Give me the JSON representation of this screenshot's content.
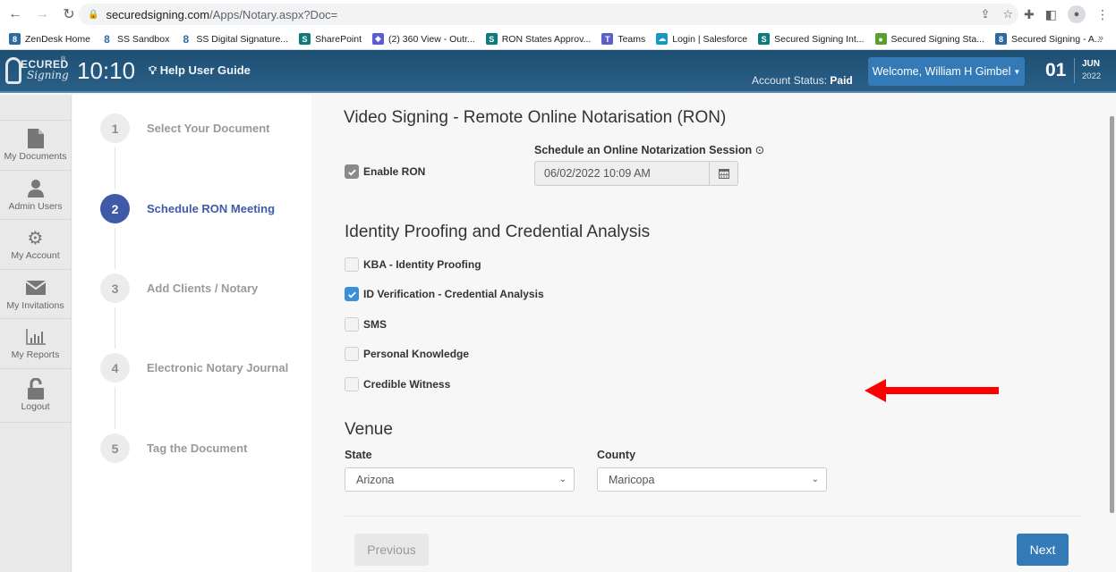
{
  "browser": {
    "url_host": "securedsigning.com",
    "url_path": "/Apps/Notary.aspx?Doc=",
    "bookmarks": [
      {
        "label": "ZenDesk Home",
        "icon": "zendesk-icon",
        "color": "#2d6a9f",
        "glyph": "8"
      },
      {
        "label": "SS Sandbox",
        "icon": "secured-signing-icon",
        "color": "#ffffff",
        "glyph": "8"
      },
      {
        "label": "SS Digital Signature...",
        "icon": "secured-signing-icon",
        "color": "#ffffff",
        "glyph": "8"
      },
      {
        "label": "SharePoint",
        "icon": "sharepoint-icon",
        "color": "#0e7a7a",
        "glyph": "S"
      },
      {
        "label": "(2) 360 View - Outr...",
        "icon": "shield-icon",
        "color": "#5b5bd6",
        "glyph": "◆"
      },
      {
        "label": "RON States Approv...",
        "icon": "sharepoint-icon",
        "color": "#0e7a7a",
        "glyph": "S"
      },
      {
        "label": "Teams",
        "icon": "teams-icon",
        "color": "#5b5fc7",
        "glyph": "T"
      },
      {
        "label": "Login | Salesforce",
        "icon": "salesforce-icon",
        "color": "#1798c1",
        "glyph": "☁"
      },
      {
        "label": "Secured Signing Int...",
        "icon": "sharepoint-icon",
        "color": "#0e7a7a",
        "glyph": "S"
      },
      {
        "label": "Secured Signing Sta...",
        "icon": "status-icon",
        "color": "#5aa02c",
        "glyph": "●"
      },
      {
        "label": "Secured Signing - A...",
        "icon": "secured-signing-icon",
        "color": "#2d6a9f",
        "glyph": "8"
      }
    ],
    "more": "»"
  },
  "header": {
    "logo_top": "ECURED",
    "logo_bottom": "Signing",
    "logo_reg": "®",
    "clock": "10:10",
    "help": "Help User Guide",
    "account_status_label": "Account Status:",
    "account_status_value": "Paid",
    "welcome": "Welcome,  William H Gimbel",
    "date_day": "01",
    "date_month": "JUN",
    "date_year": "2022"
  },
  "sidebar": {
    "items": [
      {
        "label": "My Documents",
        "icon": "document-icon"
      },
      {
        "label": "Admin Users",
        "icon": "user-icon"
      },
      {
        "label": "My Account",
        "icon": "gear-icon"
      },
      {
        "label": "My Invitations",
        "icon": "envelope-icon"
      },
      {
        "label": "My Reports",
        "icon": "bar-chart-icon"
      },
      {
        "label": "Logout",
        "icon": "unlock-icon"
      }
    ]
  },
  "steps": [
    {
      "number": "1",
      "label": "Select Your Document",
      "active": false
    },
    {
      "number": "2",
      "label": "Schedule RON Meeting",
      "active": true
    },
    {
      "number": "3",
      "label": "Add Clients / Notary",
      "active": false
    },
    {
      "number": "4",
      "label": "Electronic Notary Journal",
      "active": false
    },
    {
      "number": "5",
      "label": "Tag the Document",
      "active": false
    }
  ],
  "main": {
    "title": "Video Signing - Remote Online Notarisation (RON)",
    "enable_ron": {
      "label": "Enable RON",
      "checked": true
    },
    "schedule_label": "Schedule an Online Notarization Session",
    "schedule_value": "06/02/2022 10:09 AM",
    "identity_title": "Identity Proofing and Credential Analysis",
    "identity_options": [
      {
        "label": "KBA - Identity Proofing",
        "checked": false
      },
      {
        "label": "ID Verification - Credential Analysis",
        "checked": true
      },
      {
        "label": "SMS",
        "checked": false
      },
      {
        "label": "Personal Knowledge",
        "checked": false
      },
      {
        "label": "Credible Witness",
        "checked": false
      }
    ],
    "venue_title": "Venue",
    "state_label": "State",
    "state_value": "Arizona",
    "county_label": "County",
    "county_value": "Maricopa",
    "previous": "Previous",
    "next": "Next"
  },
  "colors": {
    "header": "#245779",
    "accent": "#337ab7",
    "active_step": "#3f5aa6",
    "annotation_arrow": "#ff0000"
  }
}
